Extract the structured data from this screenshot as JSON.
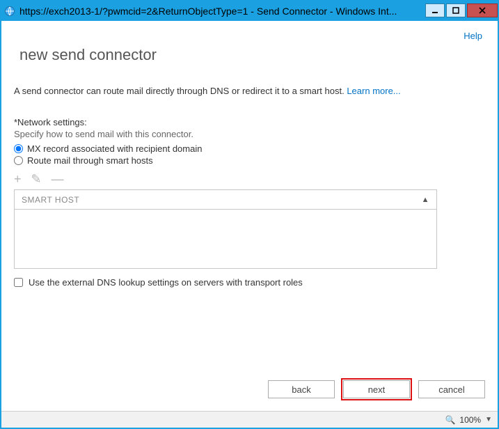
{
  "window": {
    "title": "https://exch2013-1/?pwmcid=2&ReturnObjectType=1 - Send Connector - Windows Int..."
  },
  "help": {
    "label": "Help"
  },
  "page": {
    "title": "new send connector",
    "intro_text": "A send connector can route mail directly through DNS or redirect it to a smart host. ",
    "learn_more": "Learn more...",
    "section_label": "*Network settings:",
    "section_sub": "Specify how to send mail with this connector.",
    "radio_mx": "MX record associated with recipient domain",
    "radio_smart": "Route mail through smart hosts",
    "grid_header": "SMART HOST",
    "chk_label": "Use the external DNS lookup settings on servers with transport roles"
  },
  "toolbar": {
    "add": "+",
    "edit": "✎",
    "remove": "—"
  },
  "buttons": {
    "back": "back",
    "next": "next",
    "cancel": "cancel"
  },
  "status": {
    "zoom": "100%"
  },
  "radio_selected": "mx",
  "chk_external_dns": false
}
